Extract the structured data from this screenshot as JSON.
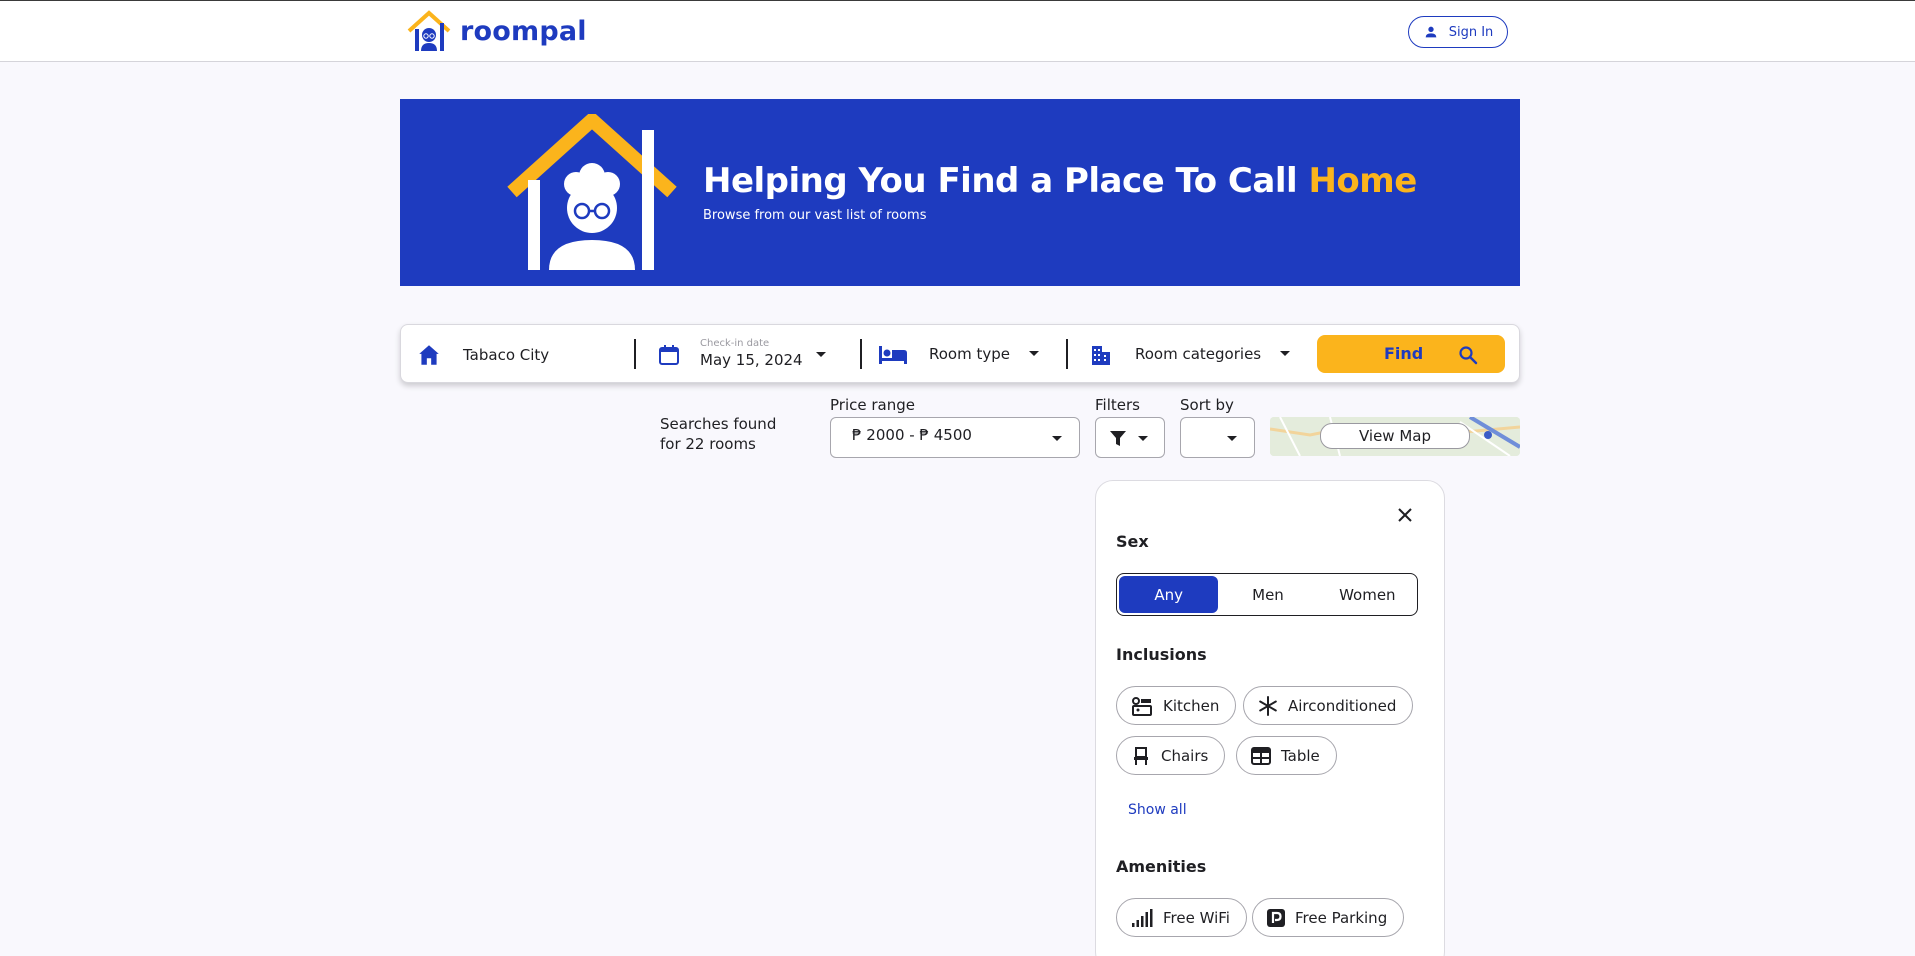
{
  "brand": {
    "name": "roompal",
    "primary": "#1e3bbf",
    "accent": "#fbb41c"
  },
  "header": {
    "signin_label": "Sign In",
    "user_icon": "person-icon"
  },
  "hero": {
    "title_main": "Helping You Find a Place To Call ",
    "title_accent": "Home",
    "subtitle": "Browse from our vast list of rooms"
  },
  "search": {
    "location": {
      "value": "Tabaco City",
      "icon": "home-icon"
    },
    "checkin": {
      "label": "Check-in date",
      "value": "May 15, 2024",
      "icon": "calendar-icon"
    },
    "room_type": {
      "label": "Room type",
      "icon": "bed-icon"
    },
    "room_categories": {
      "label": "Room categories",
      "icon": "building-icon"
    },
    "find_label": "Find"
  },
  "results": {
    "count_text": "Searches found for 22 rooms",
    "price_range": {
      "label": "Price range",
      "value": "₱ 2000 - ₱ 4500"
    },
    "filters_label": "Filters",
    "sort_label": "Sort by",
    "sort_value": "",
    "view_map_label": "View Map"
  },
  "filter_panel": {
    "sex": {
      "title": "Sex",
      "options": [
        "Any",
        "Men",
        "Women"
      ],
      "selected": "Any"
    },
    "inclusions": {
      "title": "Inclusions",
      "items": [
        {
          "label": "Kitchen",
          "icon": "kitchen-icon"
        },
        {
          "label": "Airconditioned",
          "icon": "snowflake-icon"
        },
        {
          "label": "Chairs",
          "icon": "chair-icon"
        },
        {
          "label": "Table",
          "icon": "table-icon"
        }
      ],
      "show_all_label": "Show all"
    },
    "amenities": {
      "title": "Amenities",
      "items": [
        {
          "label": "Free WiFi",
          "icon": "signal-icon"
        },
        {
          "label": "Free Parking",
          "icon": "parking-icon"
        }
      ]
    }
  }
}
